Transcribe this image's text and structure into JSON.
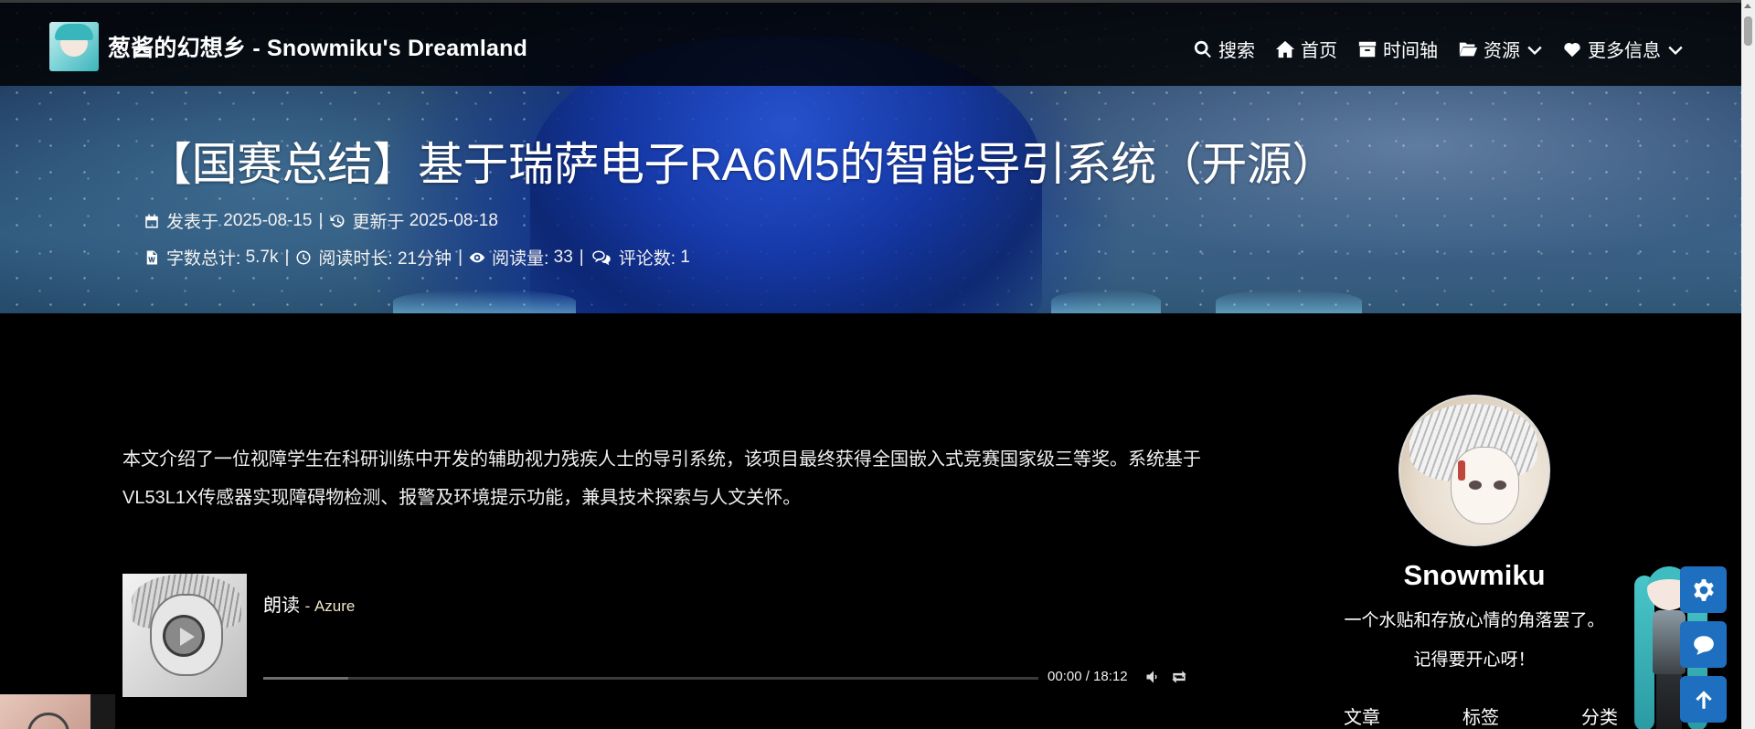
{
  "site": {
    "title": "葱酱的幻想乡 - Snowmiku's Dreamland"
  },
  "nav": {
    "items": [
      {
        "label": "搜索",
        "icon": "search-icon"
      },
      {
        "label": "首页",
        "icon": "home-icon"
      },
      {
        "label": "时间轴",
        "icon": "archive-icon"
      },
      {
        "label": "资源",
        "icon": "folder-open-icon",
        "dropdown": true
      },
      {
        "label": "更多信息",
        "icon": "heart-icon",
        "dropdown": true
      }
    ]
  },
  "post": {
    "title": "【国赛总结】基于瑞萨电子RA6M5的智能导引系统（开源）",
    "published_label": "发表于",
    "published": "2025-08-15",
    "updated_label": "更新于",
    "updated": "2025-08-18",
    "wordcount_label": "字数总计:",
    "wordcount": "5.7k",
    "readtime_label": "阅读时长:",
    "readtime": "21分钟",
    "views_label": "阅读量:",
    "views": "33",
    "comments_label": "评论数:",
    "comments": "1",
    "separator": "|",
    "summary": "本文介绍了一位视障学生在科研训练中开发的辅助视力残疾人士的导引系统，该项目最终获得全国嵌入式竞赛国家级三等奖。系统基于VL53L1X传感器实现障碍物检测、报警及环境提示功能，兼具技术探索与人文关怀。"
  },
  "player": {
    "track": "朗读",
    "artist": "- Azure",
    "time": "00:00 / 18:12",
    "buffered": 0.11
  },
  "profile": {
    "name": "Snowmiku",
    "bio1": "一个水贴和存放心情的角落罢了。",
    "bio2": "记得要开心呀！",
    "stats": [
      "文章",
      "标签",
      "分类"
    ]
  },
  "colors": {
    "accent": "#1e6fbf",
    "navbar": "#000000"
  }
}
